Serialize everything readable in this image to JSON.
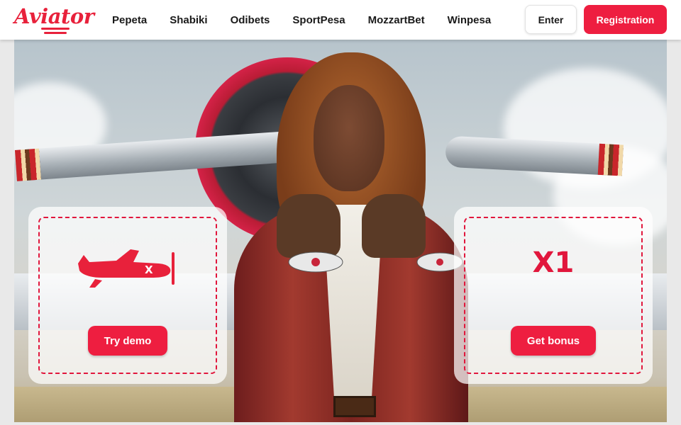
{
  "header": {
    "logo_text": "Aviator",
    "nav": [
      "Pepeta",
      "Shabiki",
      "Odibets",
      "SportPesa",
      "MozzartBet",
      "Winpesa"
    ],
    "enter_label": "Enter",
    "registration_label": "Registration"
  },
  "cards": {
    "demo": {
      "button_label": "Try demo",
      "icon": "plane-icon"
    },
    "bonus": {
      "multiplier": "X1",
      "button_label": "Get bonus"
    }
  },
  "colors": {
    "brand": "#ee1e40",
    "header_bg": "#ffffff"
  }
}
